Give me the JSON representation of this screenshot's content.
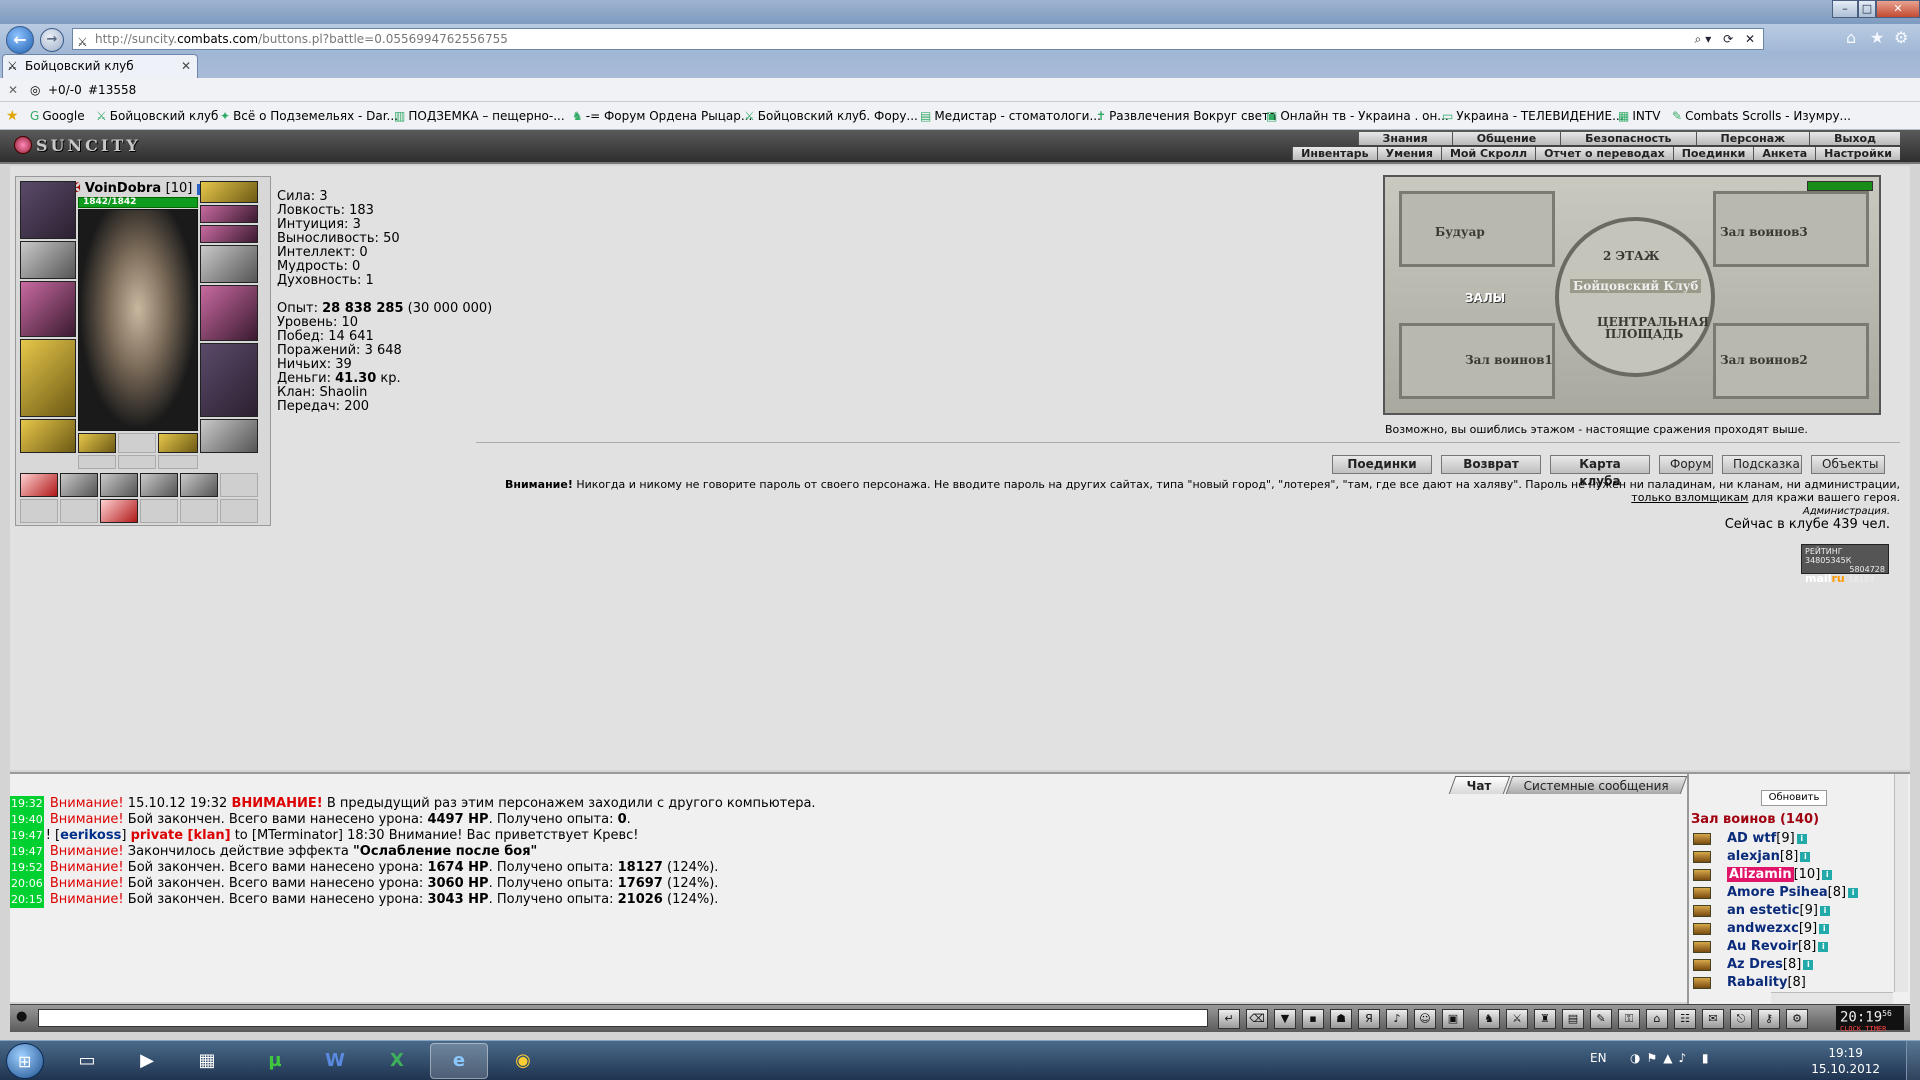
{
  "browser": {
    "url_prefix": "http://suncity.",
    "url_domain": "combats.com",
    "url_path": "/buttons.pl?battle=0.0556994762556755",
    "tab_title": "Бойцовский клуб",
    "status_left": "+0/-0",
    "status_right": "#13558",
    "favorites": [
      "Google",
      "Бойцовский клуб",
      "Всё о Подземельях - Dar...",
      "ПОДЗЕМКА – пещерно-...",
      "-= Форум Ордена Рыцар...",
      "Бойцовский клуб. Фору...",
      "Медистар - стоматологи...",
      "Развлечения Вокруг света",
      "Онлайн тв - Украина . он...",
      "Украина - ТЕЛЕВИДЕНИЕ...",
      "INTV",
      "Combats Scrolls - Изумру..."
    ]
  },
  "game": {
    "logo": "SUNCITY",
    "menu_top": [
      "Знания",
      "Общение",
      "Безопасность",
      "Персонаж",
      "Выход"
    ],
    "menu_bottom": [
      "Инвентарь",
      "Умения",
      "Мой Скролл",
      "Отчет о переводах",
      "Поединки",
      "Анкета",
      "Настройки"
    ]
  },
  "character": {
    "name": "VoinDobra",
    "level": "[10]",
    "hp": "1842/1842",
    "stats": [
      {
        "label": "Сила:",
        "value": "3"
      },
      {
        "label": "Ловкость:",
        "value": "183"
      },
      {
        "label": "Интуиция:",
        "value": "3"
      },
      {
        "label": "Выносливость:",
        "value": "50"
      },
      {
        "label": "Интеллект:",
        "value": "0"
      },
      {
        "label": "Мудрость:",
        "value": "0"
      },
      {
        "label": "Духовность:",
        "value": "1"
      }
    ],
    "exp_label": "Опыт:",
    "exp_value": "28 838 285",
    "exp_next": "(30 000 000)",
    "level_label": "Уровень:",
    "level_value": "10",
    "wins_label": "Побед:",
    "wins_value": "14 641",
    "losses_label": "Поражений:",
    "losses_value": "3 648",
    "draws_label": "Ничьих:",
    "draws_value": "39",
    "money_label": "Деньги:",
    "money_value": "41.30",
    "money_unit": "кр.",
    "clan_label": "Клан:",
    "clan_value": "Shaolin",
    "transfers_label": "Передач:",
    "transfers_value": "200"
  },
  "map": {
    "room_tl": "Будуар",
    "room_tr": "Зал воинов3",
    "room_bl": "Зал воинов1",
    "room_br": "Зал воинов2",
    "floor": "2 ЭТАЖ",
    "club": "Бойцовский Клуб",
    "halls": "ЗАЛЫ",
    "square_1": "ЦЕНТРАЛЬНАЯ",
    "square_2": "ПЛОЩАДЬ",
    "note": "Возможно, вы ошиблись этажом - настоящие сражения проходят выше."
  },
  "buttons": [
    "Поединки",
    "Возврат",
    "Карта клуба",
    "Форум",
    "Подсказка",
    "Объекты"
  ],
  "warning": {
    "bold": "Внимание!",
    "text": "Никогда и никому не говорите пароль от своего персонажа. Не вводите пароль на других сайтах, типа \"новый город\", \"лотерея\", \"там, где все дают на халяву\". Пароль не нужен ни паладинам, ни кланам, ни администрации,",
    "link": "только взломщикам",
    "tail": "для кражи вашего героя.",
    "admin": "Администрация.",
    "online": "Сейчас в клубе 439 чел."
  },
  "counter": {
    "line1": "РЕЙТИНГ 34805345К",
    "line2": "5804728",
    "line3": "18103",
    "mail": "mail",
    "ru": "ru"
  },
  "chat": {
    "tabs": [
      "Чат",
      "Системные сообщения"
    ],
    "lines": [
      {
        "ts": "19:32",
        "att": "Внимание!",
        "pre": "15.10.12 19:32",
        "bold": "ВНИМАНИЕ!",
        "rest": "В предыдущий раз этим персонажем заходили с другого компьютера."
      },
      {
        "ts": "19:40",
        "att": "Внимание!",
        "a": "Бой закончен. Всего вами нанесено урона:",
        "b": "4497 HP",
        "c": ". Получено опыта:",
        "d": "0",
        "e": "."
      },
      {
        "ts": "19:47",
        "sender": "eerikoss",
        "priv": "private [klan]",
        "to": "to [MTerminator] 18:30 Внимание! Вас приветствует Кревс!"
      },
      {
        "ts": "19:47",
        "att": "Внимание!",
        "a": "Закончилось действие эффекта",
        "b": "\"Ослабление после боя\""
      },
      {
        "ts": "19:52",
        "att": "Внимание!",
        "a": "Бой закончен. Всего вами нанесено урона:",
        "b": "1674 HP",
        "c": ". Получено опыта:",
        "d": "18127",
        "e": "(124%)."
      },
      {
        "ts": "20:06",
        "att": "Внимание!",
        "a": "Бой закончен. Всего вами нанесено урона:",
        "b": "3060 HP",
        "c": ". Получено опыта:",
        "d": "17697",
        "e": "(124%)."
      },
      {
        "ts": "20:15",
        "att": "Внимание!",
        "a": "Бой закончен. Всего вами нанесено урона:",
        "b": "3043 HP",
        "c": ". Получено опыта:",
        "d": "21026",
        "e": "(124%)."
      }
    ]
  },
  "online_panel": {
    "refresh": "Обновить",
    "room": "Зал воинов (140)",
    "users": [
      {
        "name": "AD wtf",
        "level": "[9]"
      },
      {
        "name": "alexjan",
        "level": "[8]"
      },
      {
        "name": "Alizamin",
        "level": "[10]"
      },
      {
        "name": "Amore Psihea",
        "level": "[8]"
      },
      {
        "name": "an estetic",
        "level": "[9]"
      },
      {
        "name": "andwezxc",
        "level": "[9]"
      },
      {
        "name": "Au Revoir",
        "level": "[8]"
      },
      {
        "name": "Az Dres",
        "level": "[8]"
      },
      {
        "name": "Rabality",
        "level": "[8]"
      }
    ]
  },
  "game_clock": {
    "time": "20:19",
    "sec": "56",
    "labels": "CLOCK TIMER"
  },
  "taskbar": {
    "lang": "EN",
    "time": "19:19",
    "date": "15.10.2012"
  }
}
